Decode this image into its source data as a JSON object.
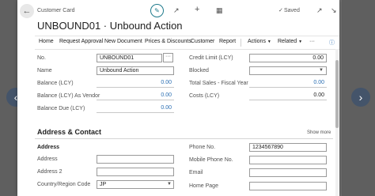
{
  "card": {
    "caption": "Customer Card",
    "title": "UNBOUND01 · Unbound Action",
    "status": "Saved"
  },
  "icons": {
    "back": "arrow-left",
    "edit": "pencil",
    "share": "share",
    "new": "plus",
    "delete": "trash",
    "saved": "checkmark",
    "popout": "open-in-new-window",
    "collapse": "collapse",
    "prev": "chevron-left",
    "next": "chevron-right",
    "info": "info"
  },
  "actions": [
    "Home",
    "Request Approval",
    "New Document",
    "Prices & Discounts",
    "Customer",
    "Report",
    "Actions",
    "Related"
  ],
  "general": {
    "no_label": "No.",
    "no_value": "UNBOUND01",
    "name_label": "Name",
    "name_value": "Unbound Action",
    "balance_label": "Balance (LCY)",
    "balance_value": "0.00",
    "balance_vendor_label": "Balance (LCY) As Vendor",
    "balance_vendor_value": "0.00",
    "balance_due_label": "Balance Due (LCY)",
    "balance_due_value": "0.00",
    "credit_limit_label": "Credit Limit (LCY)",
    "credit_limit_value": "0.00",
    "blocked_label": "Blocked",
    "blocked_value": "",
    "total_sales_label": "Total Sales - Fiscal Year",
    "total_sales_value": "0.00",
    "costs_label": "Costs (LCY)",
    "costs_value": "0.00"
  },
  "address_section": {
    "title": "Address & Contact",
    "show_more": "Show more",
    "subheading": "Address",
    "address_label": "Address",
    "address_value": "",
    "address2_label": "Address 2",
    "address2_value": "",
    "country_label": "Country/Region Code",
    "country_value": "JP",
    "phone_label": "Phone No.",
    "phone_value": "1234567890",
    "mobile_label": "Mobile Phone No.",
    "mobile_value": "",
    "email_label": "Email",
    "email_value": "",
    "homepage_label": "Home Page",
    "homepage_value": ""
  }
}
